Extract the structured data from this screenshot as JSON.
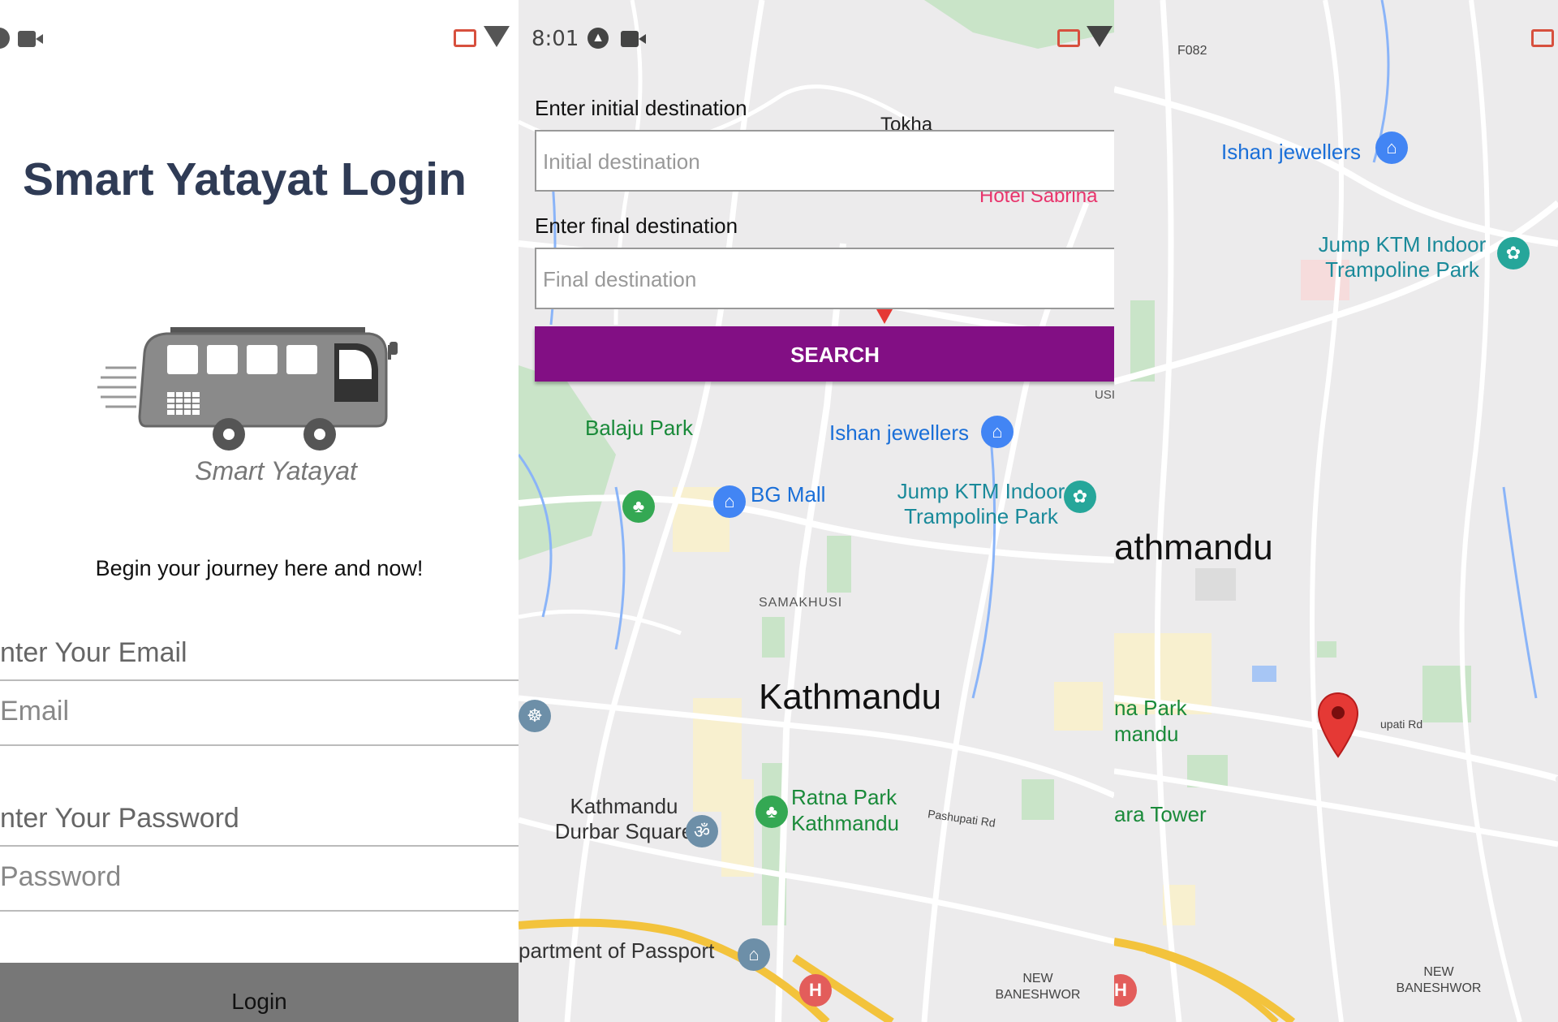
{
  "login": {
    "title": "Smart Yatayat Login",
    "logo_text": "Smart Yatayat",
    "tagline": "Begin your journey here and now!",
    "email_label": "nter Your Email",
    "email_placeholder": "Email",
    "password_label": "nter Your Password",
    "password_placeholder": "Password",
    "login_button": "Login"
  },
  "search": {
    "time": "8:01",
    "initial_label": "Enter initial destination",
    "initial_placeholder": "Initial destination",
    "final_label": "Enter final destination",
    "final_placeholder": "Final destination",
    "search_button": "SEARCH"
  },
  "map_middle": {
    "tokha": "Tokha",
    "hotel": "Hotel Sabrina",
    "balaju": "Balaju Park",
    "ishan": "Ishan jewellers",
    "bg_mall": "BG Mall",
    "jump_1": "Jump KTM Indoor",
    "jump_2": "Trampoline Park",
    "samakhusi": "SAMAKHUSI",
    "kathmandu": "Kathmandu",
    "durbar_1": "Kathmandu",
    "durbar_2": "Durbar Square",
    "ratna_1": "Ratna Park",
    "ratna_2": "Kathmandu",
    "pashupati": "Pashupati Rd",
    "passport": "partment of Passport",
    "new_1": "NEW",
    "new_2": "BANESHWOR",
    "usi": "USI"
  },
  "map_right": {
    "f082": "F082",
    "ishan": "Ishan jewellers",
    "jump_1": "Jump KTM Indoor",
    "jump_2": "Trampoline Park",
    "kathmandu": "athmandu",
    "ratna_1": "na Park",
    "ratna_2": "mandu",
    "tower": "ara Tower",
    "pashupati": "upati Rd",
    "new_1": "NEW",
    "new_2": "BANESHWOR"
  },
  "colors": {
    "title": "#2f3b55",
    "search_button": "#820f84",
    "login_button": "#777777",
    "marker": "#e53935",
    "map_bg": "#ecebec"
  }
}
